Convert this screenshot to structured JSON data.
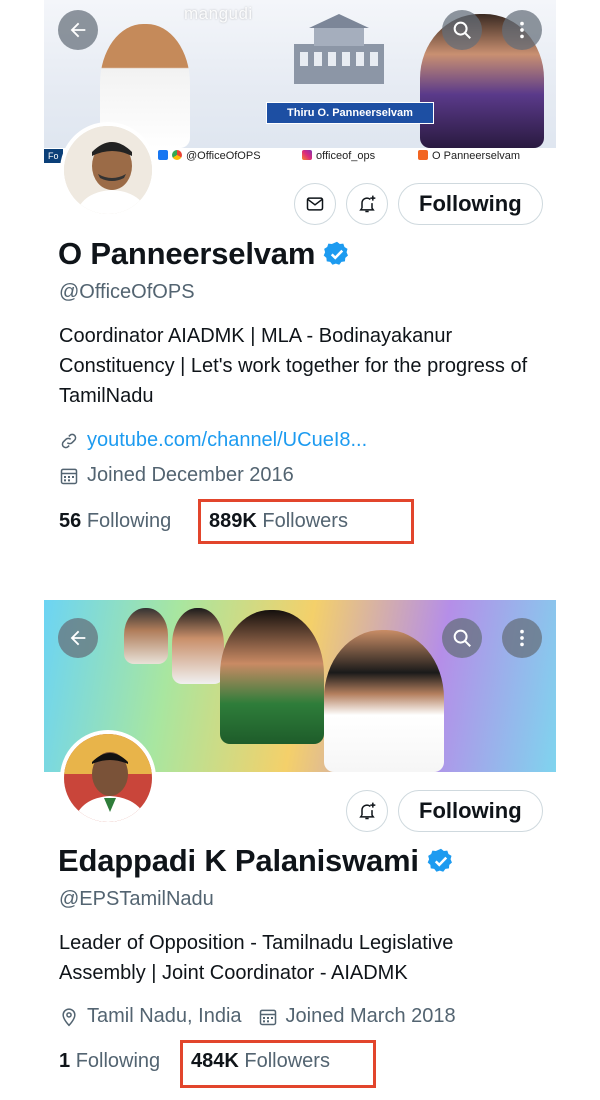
{
  "profiles": [
    {
      "banner": {
        "watermark": "mangudi",
        "caption": "Thiru O. Panneerselvam",
        "social_tab": "Fo",
        "social_facebook": "@OfficeOfOPS",
        "social_instagram": "officeof_ops",
        "social_youtube": "O Panneerselvam"
      },
      "follow_label": "Following",
      "display_name": "O Panneerselvam",
      "handle": "@OfficeOfOPS",
      "bio": "Coordinator AIADMK  |  MLA - Bodinayakanur Constituency  |  Let's work together for the progress of TamilNadu",
      "link": "youtube.com/channel/UCueI8...",
      "joined": "Joined December 2016",
      "following_count": "56",
      "following_label": "Following",
      "followers_count": "889K",
      "followers_label": "Followers"
    },
    {
      "follow_label": "Following",
      "display_name": "Edappadi K Palaniswami",
      "handle": "@EPSTamilNadu",
      "bio": "Leader of Opposition - Tamilnadu Legislative Assembly | Joint Coordinator - AIADMK",
      "location": "Tamil Nadu, India",
      "joined": "Joined March 2018",
      "following_count": "1",
      "following_label": "Following",
      "followers_count": "484K",
      "followers_label": "Followers"
    }
  ],
  "icons": [
    "back-arrow-icon",
    "search-icon",
    "more-vertical-icon",
    "mail-icon",
    "bell-plus-icon",
    "verified-badge-icon",
    "link-icon",
    "calendar-icon",
    "location-pin-icon"
  ],
  "colors": {
    "accent": "#1d9bf0",
    "highlight": "#e2452c",
    "secondary_text": "#536471"
  }
}
